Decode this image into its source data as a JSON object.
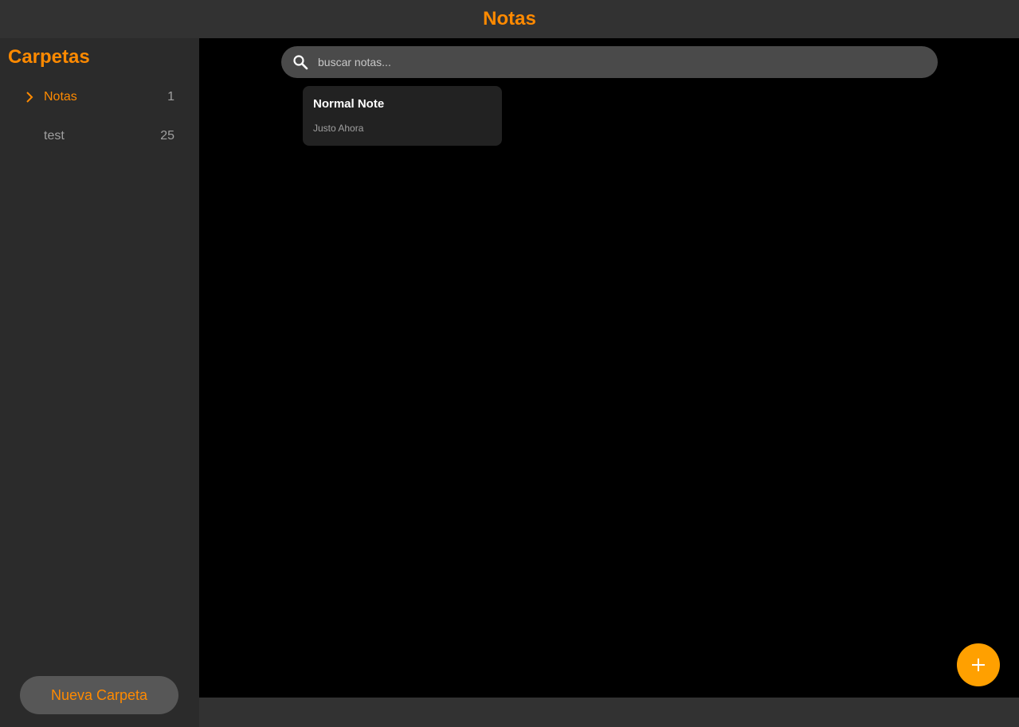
{
  "header": {
    "title": "Notas"
  },
  "sidebar": {
    "title": "Carpetas",
    "folders": [
      {
        "label": "Notas",
        "count": "1",
        "active": true
      },
      {
        "label": "test",
        "count": "25",
        "active": false
      }
    ],
    "new_folder_label": "Nueva Carpeta"
  },
  "search": {
    "placeholder": "buscar notas...",
    "value": ""
  },
  "notes": [
    {
      "title": "Normal Note",
      "time": "Justo Ahora"
    }
  ],
  "fab": {
    "icon": "plus-icon"
  },
  "colors": {
    "accent": "#ff8a00",
    "fab": "#ffa000",
    "sidebar_bg": "#2b2b2b",
    "topbar_bg": "#323232",
    "main_bg": "#000000"
  }
}
